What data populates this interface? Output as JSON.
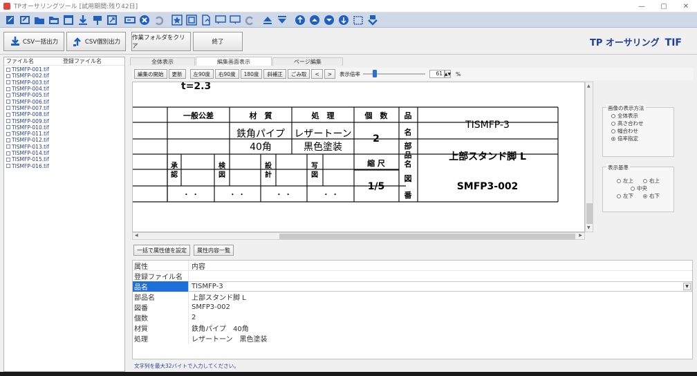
{
  "window": {
    "title": "TPオーサリングツール [試用期間:残り42日]",
    "minimize": "—",
    "maximize": "▢",
    "close": "✕"
  },
  "toolbar_icons": [
    "new-icon",
    "edit-icon",
    "folder-icon",
    "folder-open-icon",
    "window-icon",
    "download-icon",
    "import-icon",
    "export-icon",
    "form-icon",
    "delete-icon",
    "undo-icon",
    "star-icon",
    "copy-icon",
    "page-icon",
    "comment-icon",
    "comment2-icon",
    "redo-icon",
    "arrow-up-icon",
    "arrow-down-icon",
    "nav1-icon",
    "nav-up-icon",
    "nav-down-icon",
    "nav-down2-icon",
    "window2-icon",
    "save-icon"
  ],
  "buttons": {
    "csv_bulk": "CSV一括出力",
    "csv_single": "CSV個別出力",
    "clear_folder": "作業フォルダをクリア",
    "exit": "終了"
  },
  "brand": {
    "name": "TP オーサリング",
    "suffix": "TIF"
  },
  "filelist": {
    "col_name": "ファイル名",
    "col_registered": "登録ファイル名",
    "files": [
      "TISMFP-001.tif",
      "TISMFP-002.tif",
      "TISMFP-003.tif",
      "TISMFP-004.tif",
      "TISMFP-005.tif",
      "TISMFP-006.tif",
      "TISMFP-007.tif",
      "TISMFP-008.tif",
      "TISMFP-009.tif",
      "TISMFP-010.tif",
      "TISMFP-011.tif",
      "TISMFP-012.tif",
      "TISMFP-013.tif",
      "TISMFP-014.tif",
      "TISMFP-015.tif",
      "TISMFP-016.tif"
    ]
  },
  "tabs": [
    "全体表示",
    "編集画面表示",
    "ページ編集"
  ],
  "edit_toolbar": {
    "start_edit": "編集の開始",
    "refresh": "更新",
    "rot_right": "左90度",
    "rot_left": "右90度",
    "rot_180": "180度",
    "skew": "斜補正",
    "denoise": "ごみ取",
    "prev": "<",
    "next": ">",
    "zoom_label": "表示倍率",
    "zoom_value": "61",
    "zoom_unit": "%",
    "zoom_fraction": 0.17
  },
  "drawing": {
    "top_fragment": "t=2.3",
    "tolerance": "一般公差",
    "material_h": "材　質",
    "treatment_h": "処　理",
    "qty_h": "個　数",
    "name_h1": "品",
    "name_h2": "名",
    "part_h1": "部",
    "part_h2": "品",
    "part_h3": "名",
    "material_v1": "鉄角パイプ",
    "material_v2": "40角",
    "treatment_v1": "レザートーン",
    "treatment_v2": "黒色塗装",
    "qty_v": "2",
    "product_name": "TISMFP-3",
    "part_name": "上部スタンド脚 L",
    "scale_h": "縮 尺",
    "scale_v": "1/5",
    "drawing_h1": "図",
    "drawing_h2": "番",
    "drawing_no": "SMFP3-002",
    "approve1": "承",
    "approve2": "認",
    "check1": "検",
    "check2": "図",
    "design1": "設",
    "design2": "計",
    "draw1": "写",
    "draw2": "図",
    "dots": "・  ・"
  },
  "display_method": {
    "title": "画像の表示方法",
    "options": [
      "全体表示",
      "高さ合わせ",
      "幅合わせ",
      "倍率指定"
    ],
    "selected": "倍率指定"
  },
  "display_origin": {
    "title": "表示基準",
    "top_left": "左上",
    "top_right": "右上",
    "center": "中央",
    "bottom_left": "左下",
    "bottom_right": "右下",
    "selected": "右下"
  },
  "attr_buttons": {
    "bulk_set": "一括で属性値を設定",
    "list": "属性内容一覧"
  },
  "attributes": {
    "col_attr": "属性",
    "col_value": "内容",
    "rows": [
      {
        "k": "登録ファイル名",
        "v": ""
      },
      {
        "k": "品名",
        "v": "TISMFP-3"
      },
      {
        "k": "部品名",
        "v": "上部スタンド脚 L"
      },
      {
        "k": "図番",
        "v": "SMFP3-002"
      },
      {
        "k": "個数",
        "v": "2"
      },
      {
        "k": "材質",
        "v": "鉄角パイプ　40角"
      },
      {
        "k": "処理",
        "v": "レザートーン　黒色塗装"
      }
    ]
  },
  "hint": "文字列を最大32バイトで入力してください。",
  "colors": {
    "accent": "#1e6fd9",
    "toolbar_icon": "#1f5fbf",
    "brand": "#1f3d99"
  }
}
